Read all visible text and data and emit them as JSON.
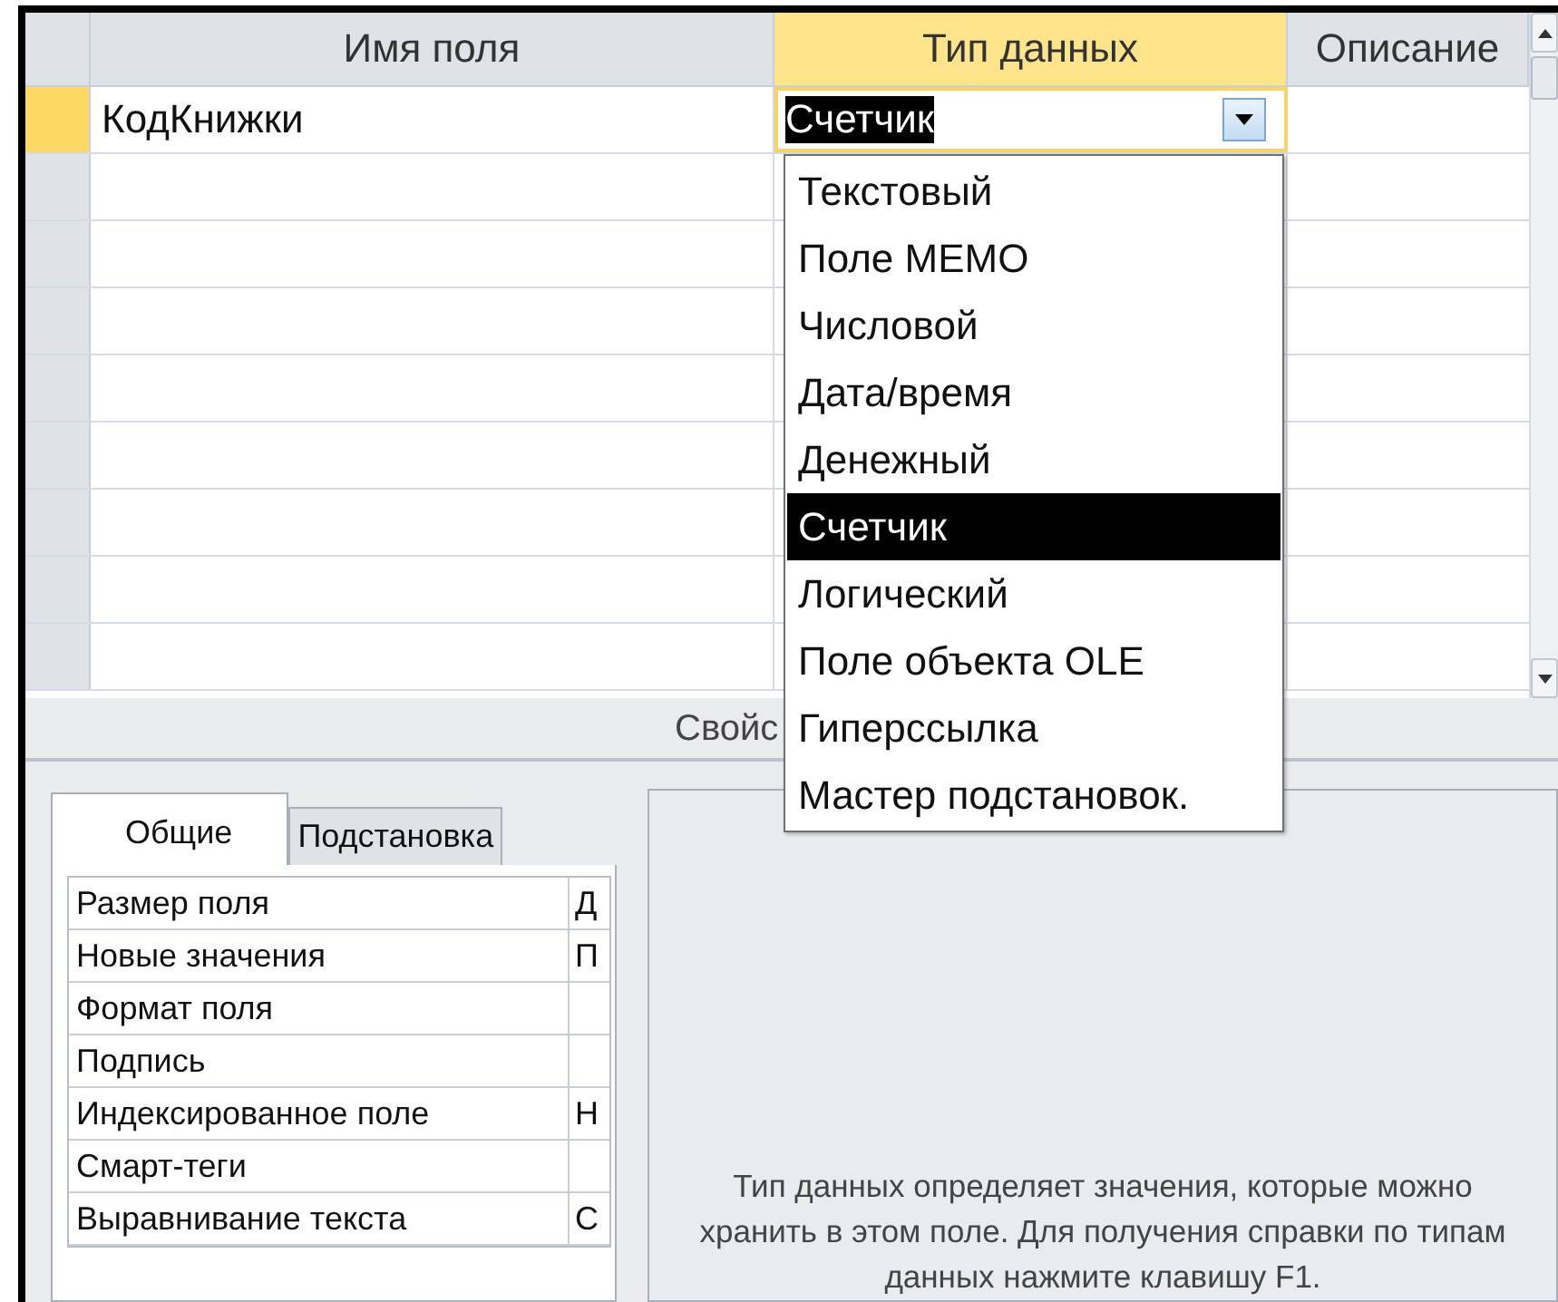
{
  "grid": {
    "columns": [
      {
        "label": "Имя поля",
        "selected": false
      },
      {
        "label": "Тип данных",
        "selected": true
      },
      {
        "label": "Описание",
        "selected": false
      }
    ],
    "rows": [
      {
        "name": "КодКнижки",
        "type": "Счетчик",
        "selected": true
      }
    ]
  },
  "type_dropdown": {
    "options": [
      {
        "label": "Текстовый",
        "selected": false
      },
      {
        "label": "Поле МЕМО",
        "selected": false
      },
      {
        "label": "Числовой",
        "selected": false
      },
      {
        "label": "Дата/время",
        "selected": false
      },
      {
        "label": "Денежный",
        "selected": false
      },
      {
        "label": "Счетчик",
        "selected": true
      },
      {
        "label": "Логический",
        "selected": false
      },
      {
        "label": "Поле объекта OLE",
        "selected": false
      },
      {
        "label": "Гиперссылка",
        "selected": false
      },
      {
        "label": "Мастер подстановок.",
        "selected": false
      }
    ]
  },
  "properties_header": "Свойс",
  "property_tabs": [
    {
      "label": "Общие",
      "selected": true
    },
    {
      "label": "Подстановка",
      "selected": false
    }
  ],
  "properties": [
    {
      "label": "Размер поля",
      "value": "Д"
    },
    {
      "label": "Новые значения",
      "value": "П"
    },
    {
      "label": "Формат поля"
    },
    {
      "label": "Подпись"
    },
    {
      "label": "Индексированное поле",
      "value": "Н"
    },
    {
      "label": "Смарт-теги"
    },
    {
      "label": "Выравнивание текста",
      "value": "С"
    }
  ],
  "help_text": "Тип данных определяет значения, которые можно хранить в этом поле. Для получения справки по типам данных нажмите клавишу F1."
}
